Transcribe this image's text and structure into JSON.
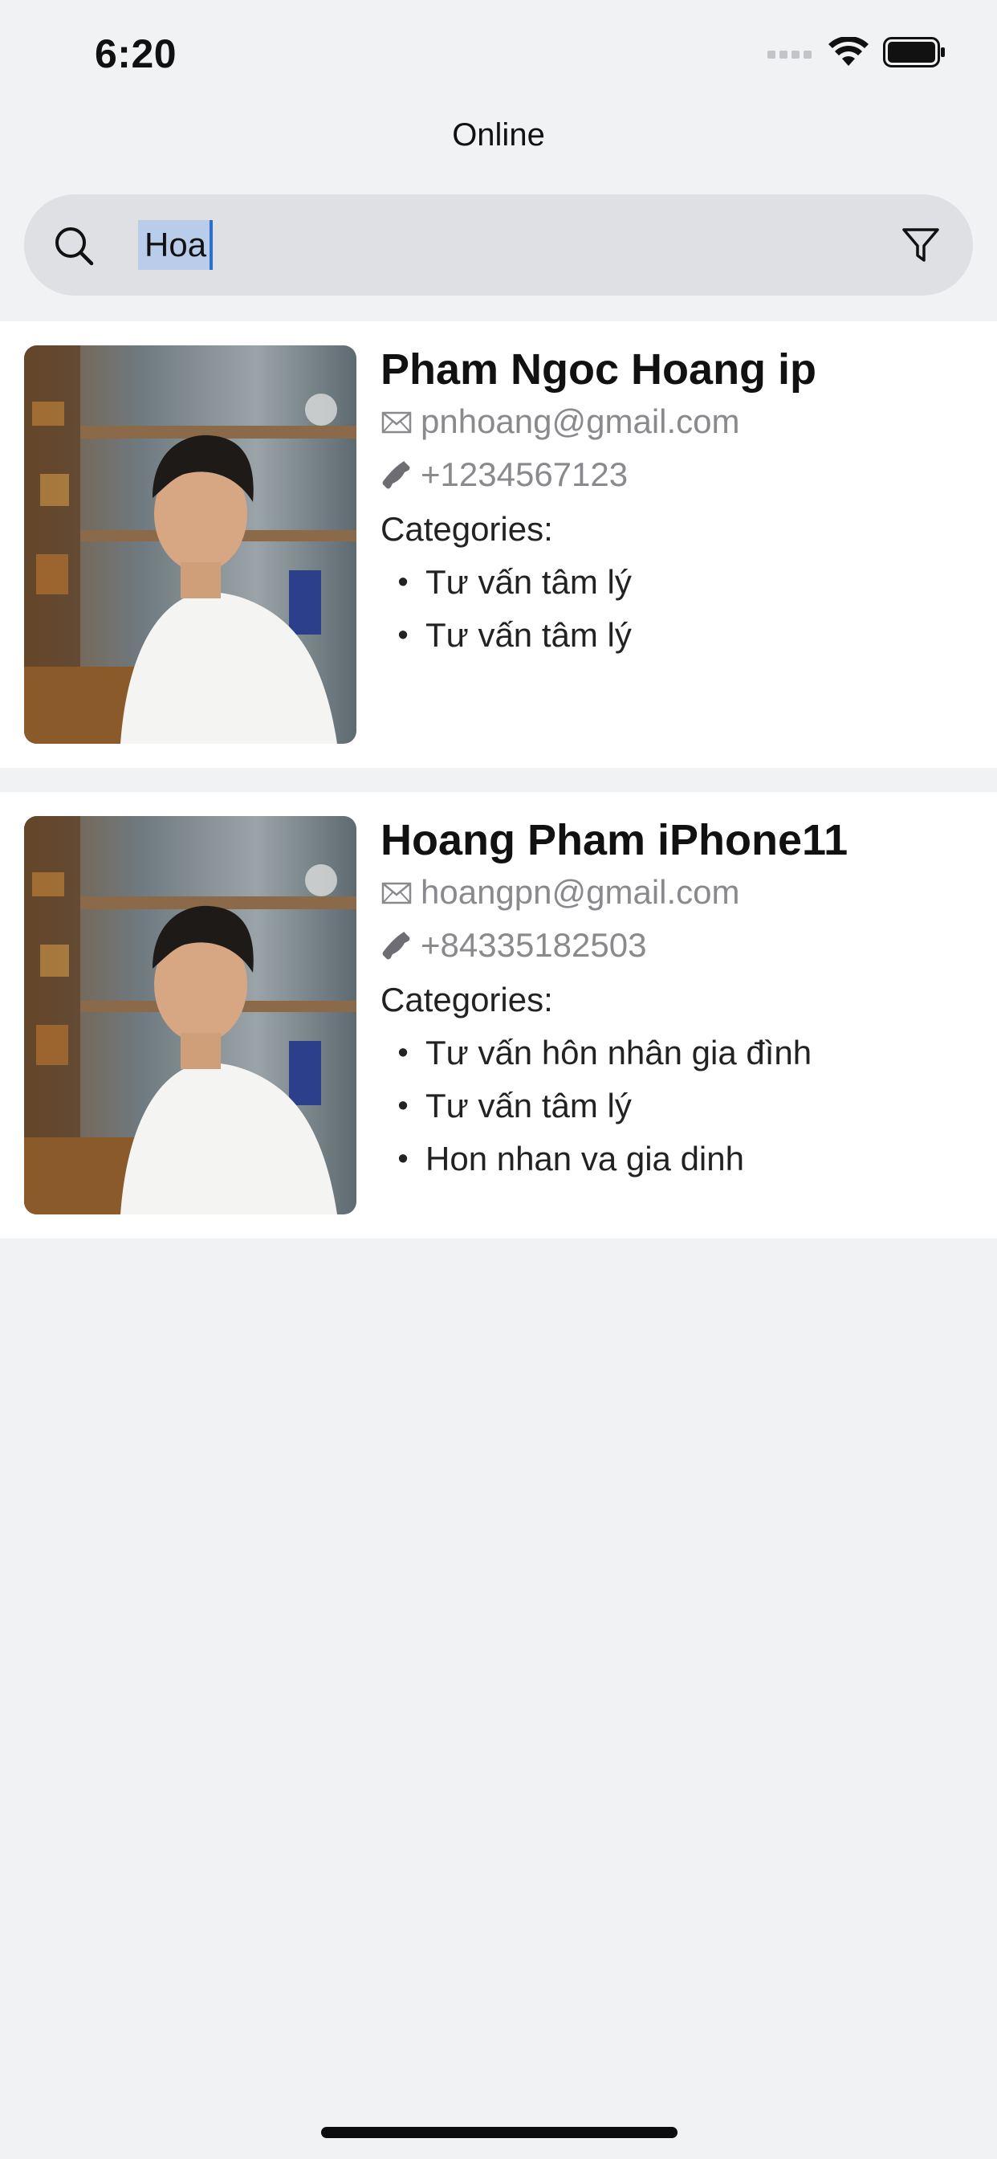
{
  "status": {
    "time": "6:20"
  },
  "nav": {
    "title": "Online"
  },
  "search": {
    "value": "Hoa"
  },
  "results": [
    {
      "name": "Pham Ngoc Hoang ip",
      "email": "pnhoang@gmail.com",
      "phone": "+1234567123",
      "categories_label": "Categories:",
      "categories": [
        "Tư vấn tâm lý",
        "Tư vấn tâm lý"
      ]
    },
    {
      "name": "Hoang Pham iPhone11",
      "email": "hoangpn@gmail.com",
      "phone": "+84335182503",
      "categories_label": "Categories:",
      "categories": [
        "Tư vấn hôn nhân gia đình",
        "Tư vấn tâm lý",
        "Hon nhan va gia dinh"
      ]
    }
  ],
  "icons": {
    "search": "search-icon",
    "filter": "filter-icon",
    "email": "envelope-icon",
    "phone": "phone-icon"
  },
  "colors": {
    "background": "#f1f2f4",
    "search_bg": "#dfe0e4",
    "selection": "#b9cdea",
    "caret": "#2a6fd6",
    "meta_text": "#8a8a8e"
  }
}
